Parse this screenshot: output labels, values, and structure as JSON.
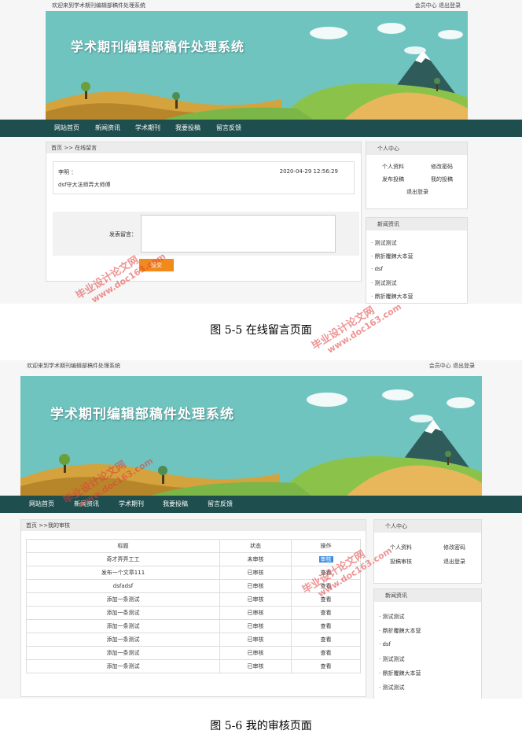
{
  "top": {
    "welcome": "欢迎来到学术期刊编辑部稿件处理系统",
    "member": "会员中心",
    "logout": "退出登录"
  },
  "banner_title": "学术期刊编辑部稿件处理系统",
  "nav": [
    "网站首页",
    "新闻资讯",
    "学术期刊",
    "我要投稿",
    "留言反馈"
  ],
  "screen1": {
    "breadcrumb": "首页 >> 在线留言",
    "message": {
      "user": "李明 ：",
      "time": "2020-04-29 12:56:29",
      "content": "dsf守大法师弄大师傅"
    },
    "form": {
      "label": "发表留言：",
      "submit": "提交"
    },
    "sidebar": {
      "personal_title": "个人中心",
      "links": [
        "个人资料",
        "修改密码",
        "发布投稿",
        "我的投稿",
        "退出登录"
      ],
      "news_title": "新闻资讯",
      "news": [
        "· 测试测试",
        "· 鼎折覆餗大本营",
        "· dsf",
        "· 测试测试",
        "· 鼎折覆餗大本营"
      ]
    }
  },
  "caption1": "图 5-5 在线留言页面",
  "screen2": {
    "breadcrumb": "首页 >>我的审核",
    "table": {
      "headers": [
        "标题",
        "状态",
        "操作"
      ],
      "rows": [
        {
          "title": "奇才弄弄工工",
          "status": "未审核",
          "action": "审核"
        },
        {
          "title": "发布一个文章111",
          "status": "已审核",
          "action": "查看"
        },
        {
          "title": "dsfadsf",
          "status": "已审核",
          "action": "查看"
        },
        {
          "title": "添加一条测试",
          "status": "已审核",
          "action": "查看"
        },
        {
          "title": "添加一条测试",
          "status": "已审核",
          "action": "查看"
        },
        {
          "title": "添加一条测试",
          "status": "已审核",
          "action": "查看"
        },
        {
          "title": "添加一条测试",
          "status": "已审核",
          "action": "查看"
        },
        {
          "title": "添加一条测试",
          "status": "已审核",
          "action": "查看"
        },
        {
          "title": "添加一条测试",
          "status": "已审核",
          "action": "查看"
        }
      ]
    },
    "sidebar": {
      "personal_title": "个人中心",
      "links": [
        "个人资料",
        "修改密码",
        "投稿审核",
        "退出登录"
      ],
      "news_title": "新闻资讯",
      "news": [
        "· 测试测试",
        "· 鼎折覆餗大本营",
        "· dsf",
        "· 测试测试",
        "· 鼎折覆餗大本营",
        "· 测试测试"
      ]
    }
  },
  "caption2": "图 5-6 我的审核页面",
  "watermark": {
    "site_cn": "毕业设计论文网",
    "site_url": "www.doc163.com"
  }
}
